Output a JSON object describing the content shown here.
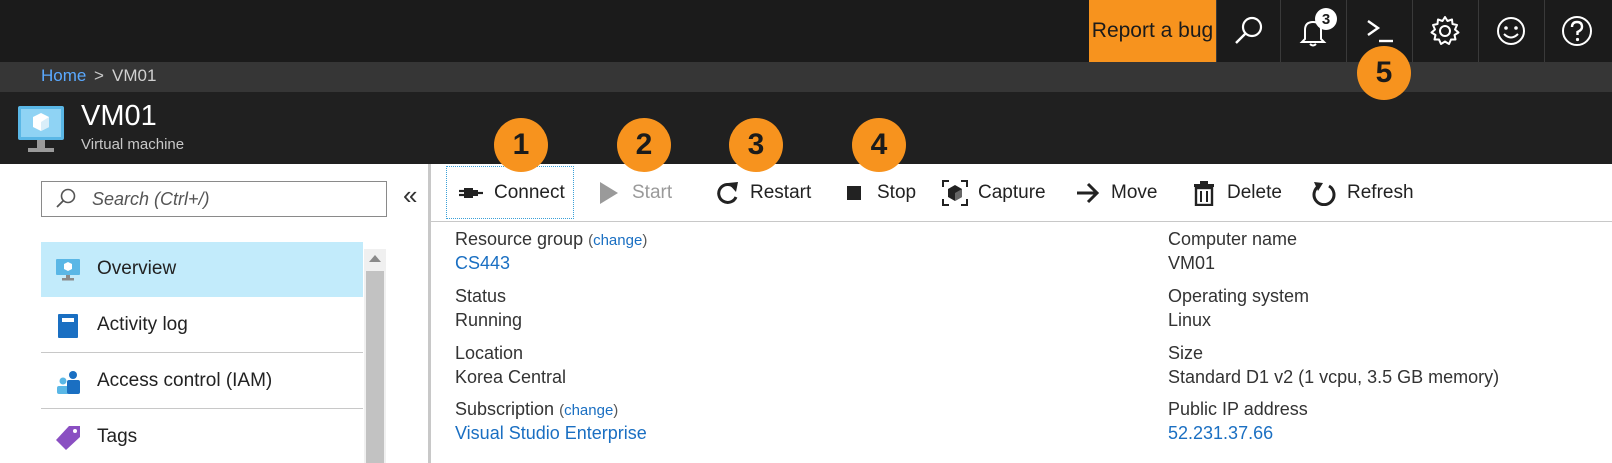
{
  "topbar": {
    "report_bug_label": "Report a bug",
    "notification_count": "3",
    "accent_color": "#f7931e"
  },
  "breadcrumb": {
    "home": "Home",
    "separator": ">",
    "current": "VM01"
  },
  "resource": {
    "title": "VM01",
    "subtitle": "Virtual machine"
  },
  "sidebar": {
    "search_placeholder": "Search (Ctrl+/)",
    "collapse_glyph": "«",
    "items": [
      {
        "label": "Overview",
        "icon": "monitor-icon",
        "active": true
      },
      {
        "label": "Activity log",
        "icon": "book-icon"
      },
      {
        "label": "Access control (IAM)",
        "icon": "people-icon"
      },
      {
        "label": "Tags",
        "icon": "tag-icon"
      }
    ]
  },
  "toolbar": {
    "connect": "Connect",
    "start": "Start",
    "restart": "Restart",
    "stop": "Stop",
    "capture": "Capture",
    "move": "Move",
    "delete": "Delete",
    "refresh": "Refresh"
  },
  "essentials": {
    "change_label": "change",
    "resource_group": {
      "label": "Resource group",
      "value": "CS443"
    },
    "status": {
      "label": "Status",
      "value": "Running"
    },
    "location": {
      "label": "Location",
      "value": "Korea Central"
    },
    "subscription": {
      "label": "Subscription",
      "value": "Visual Studio Enterprise"
    },
    "computer_name": {
      "label": "Computer name",
      "value": "VM01"
    },
    "os": {
      "label": "Operating system",
      "value": "Linux"
    },
    "size": {
      "label": "Size",
      "value": "Standard D1 v2 (1 vcpu, 3.5 GB memory)"
    },
    "public_ip": {
      "label": "Public IP address",
      "value": "52.231.37.66"
    }
  },
  "callouts": [
    "1",
    "2",
    "3",
    "4",
    "5"
  ]
}
